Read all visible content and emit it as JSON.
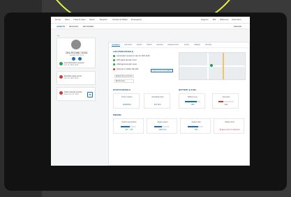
{
  "topbar": {
    "items": [
      "Home",
      "Fleet",
      "Track & trace",
      "Alerts",
      "Reports",
      "Access & Safety",
      "Emergency"
    ],
    "right_items": [
      "Support",
      "EN",
      "Welcome"
    ],
    "user": "Username"
  },
  "subnav": {
    "items": [
      "ASSETS",
      "DEVICES",
      "NETWORK"
    ],
    "right": "DRIVER"
  },
  "vehicle": {
    "id": "GN-RC088 74511",
    "subtitle": "Vehicle UNIT 12-A",
    "status": [
      {
        "title": "Last transmission received",
        "value": "Jan 10, 2019 12:00"
      },
      {
        "title": "Ecu/dash usage sensor",
        "value": "Jan 10, 2019 12:00"
      },
      {
        "title": "Trailer interlock override",
        "value": "Since Feb 10, 2019"
      }
    ]
  },
  "tabs": [
    "GENERAL",
    "HISTORY",
    "MAPS",
    "TRIPS",
    "ISSUES",
    "INSPECTION",
    "RATE",
    "SPEED",
    "ROUTE"
  ],
  "location": {
    "title": "LOCATION DETAILS",
    "rows": [
      "Last location received on Jan 10, 2019 12:00",
      "GPS signal strength: Good",
      "GSM signal strength: Good",
      "Odometer 1.0 8000 YELLOW"
    ],
    "select1": "Belgium fleet promotion",
    "select2": "Border sheet",
    "button": "VIEW ON GOOGLE MAPS"
  },
  "status_details": {
    "title": "STATUS DETAILS",
    "kpis": [
      {
        "label": "Driver mission",
        "value": "RUNNING"
      },
      {
        "label": "Operating hours",
        "value": "847.35 h"
      }
    ]
  },
  "battery": {
    "title": "BATTERY & FUEL",
    "kpis": [
      {
        "label": "Battery level",
        "value": "75%",
        "fill": 0.75
      },
      {
        "label": "Fuel level",
        "value": "30%",
        "fill": 0.3
      }
    ]
  },
  "engine": {
    "title": "ENGINE",
    "kpis": [
      {
        "label": "Engine temperature",
        "value": "237° - 90°",
        "fill": 0.6
      },
      {
        "label": "Engine speed",
        "value": "1900 rpm",
        "fill": 0.5
      },
      {
        "label": "Engine load",
        "value": "70%",
        "fill": 0.7
      },
      {
        "label": "Status errors",
        "value": "Engine error no detected",
        "fill": 0.0
      }
    ]
  },
  "colors": {
    "accent": "#1a6fb3",
    "ok": "#2e9e4a",
    "alert": "#d23a3a",
    "bezel": "#121212",
    "highlight": "#e6f24a"
  }
}
